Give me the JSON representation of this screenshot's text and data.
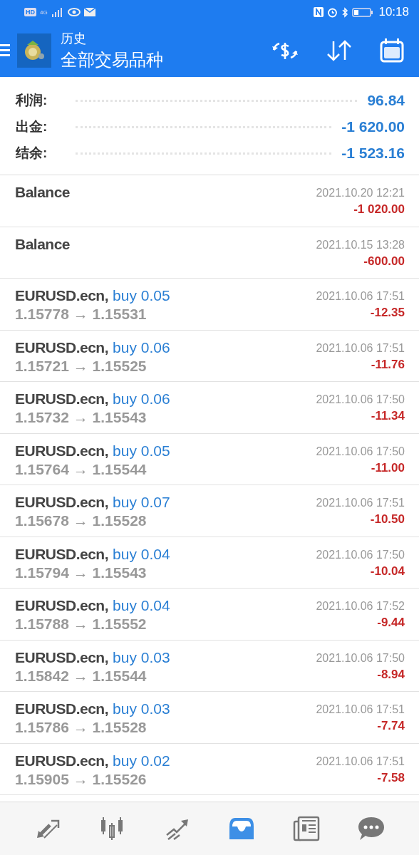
{
  "status_bar": {
    "time": "10:18",
    "network": "4G",
    "hd": "HD"
  },
  "app_bar": {
    "title": "历史",
    "subtitle": "全部交易品种"
  },
  "summary": [
    {
      "label": "利润:",
      "value": "96.84"
    },
    {
      "label": "出金:",
      "value": "-1 620.00"
    },
    {
      "label": "结余:",
      "value": "-1 523.16"
    }
  ],
  "deals": [
    {
      "kind": "balance",
      "title": "Balance",
      "time": "2021.10.20 12:21",
      "amount": "-1 020.00"
    },
    {
      "kind": "balance",
      "title": "Balance",
      "time": "2021.10.15 13:28",
      "amount": "-600.00"
    },
    {
      "kind": "trade",
      "title": "EURUSD.ecn,",
      "side": "buy 0.05",
      "prices": "1.15778 → 1.15531",
      "time": "2021.10.06 17:51",
      "amount": "-12.35"
    },
    {
      "kind": "trade",
      "title": "EURUSD.ecn,",
      "side": "buy 0.06",
      "prices": "1.15721 → 1.15525",
      "time": "2021.10.06 17:51",
      "amount": "-11.76"
    },
    {
      "kind": "trade",
      "title": "EURUSD.ecn,",
      "side": "buy 0.06",
      "prices": "1.15732 → 1.15543",
      "time": "2021.10.06 17:50",
      "amount": "-11.34"
    },
    {
      "kind": "trade",
      "title": "EURUSD.ecn,",
      "side": "buy 0.05",
      "prices": "1.15764 → 1.15544",
      "time": "2021.10.06 17:50",
      "amount": "-11.00"
    },
    {
      "kind": "trade",
      "title": "EURUSD.ecn,",
      "side": "buy 0.07",
      "prices": "1.15678 → 1.15528",
      "time": "2021.10.06 17:51",
      "amount": "-10.50"
    },
    {
      "kind": "trade",
      "title": "EURUSD.ecn,",
      "side": "buy 0.04",
      "prices": "1.15794 → 1.15543",
      "time": "2021.10.06 17:50",
      "amount": "-10.04"
    },
    {
      "kind": "trade",
      "title": "EURUSD.ecn,",
      "side": "buy 0.04",
      "prices": "1.15788 → 1.15552",
      "time": "2021.10.06 17:52",
      "amount": "-9.44"
    },
    {
      "kind": "trade",
      "title": "EURUSD.ecn,",
      "side": "buy 0.03",
      "prices": "1.15842 → 1.15544",
      "time": "2021.10.06 17:50",
      "amount": "-8.94"
    },
    {
      "kind": "trade",
      "title": "EURUSD.ecn,",
      "side": "buy 0.03",
      "prices": "1.15786 → 1.15528",
      "time": "2021.10.06 17:51",
      "amount": "-7.74"
    },
    {
      "kind": "trade",
      "title": "EURUSD.ecn,",
      "side": "buy 0.02",
      "prices": "1.15905 → 1.15526",
      "time": "2021.10.06 17:51",
      "amount": "-7.58"
    }
  ],
  "bottom_nav": [
    {
      "kind": "quotes",
      "selected": false
    },
    {
      "kind": "chart",
      "selected": false
    },
    {
      "kind": "trade",
      "selected": false
    },
    {
      "kind": "history",
      "selected": true
    },
    {
      "kind": "news",
      "selected": false
    },
    {
      "kind": "chat",
      "selected": false
    }
  ]
}
